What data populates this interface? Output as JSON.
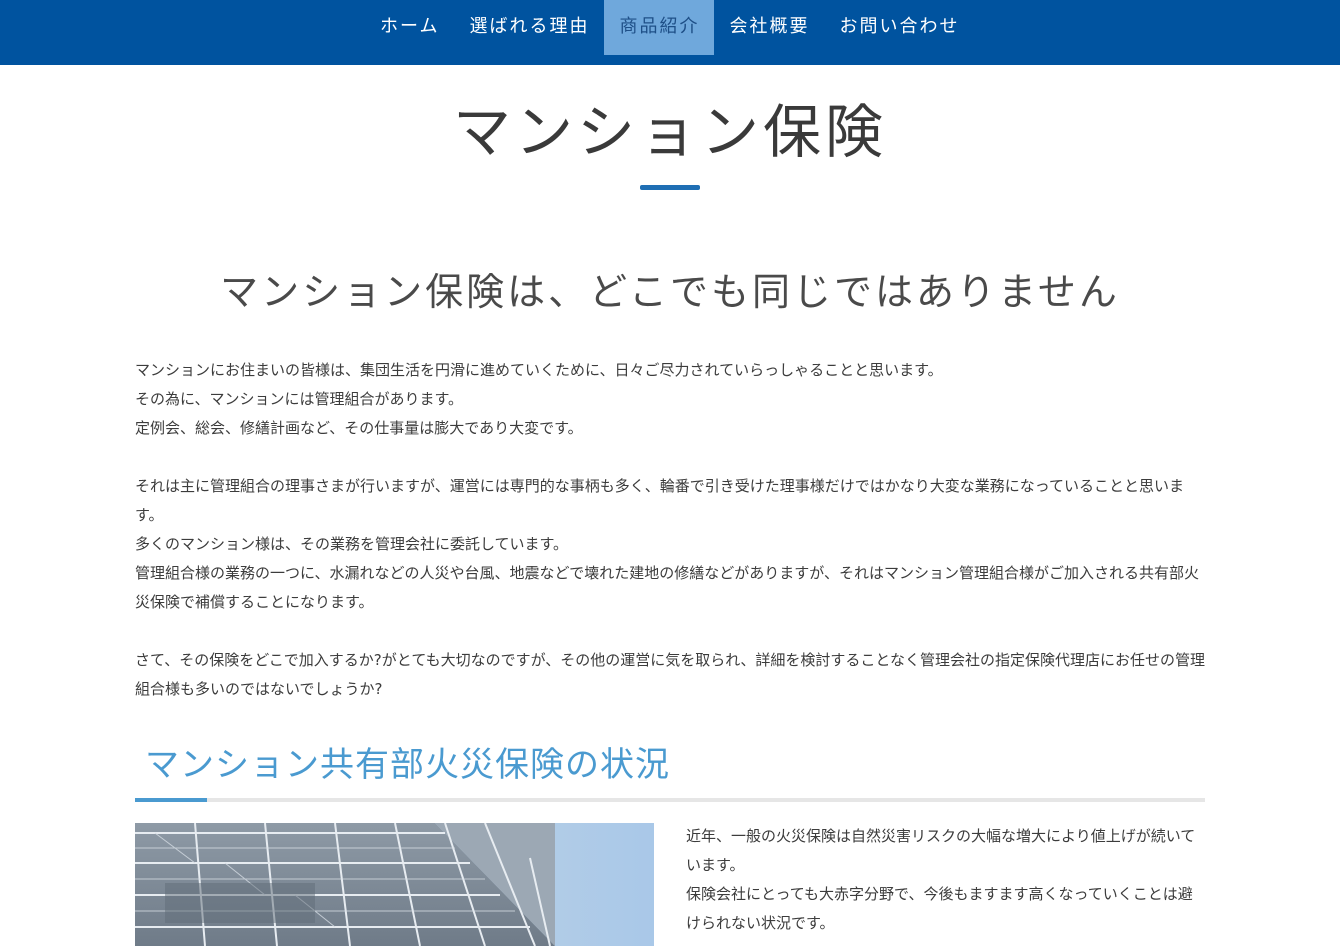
{
  "nav": {
    "items": [
      {
        "label": "ホーム",
        "active": false
      },
      {
        "label": "選ばれる理由",
        "active": false
      },
      {
        "label": "商品紹介",
        "active": true
      },
      {
        "label": "会社概要",
        "active": false
      },
      {
        "label": "お問い合わせ",
        "active": false
      }
    ]
  },
  "page": {
    "title": "マンション保険",
    "subtitle": "マンション保険は、どこでも同じではありません"
  },
  "intro": {
    "p1": "マンションにお住まいの皆様は、集団生活を円滑に進めていくために、日々ご尽力されていらっしゃることと思います。",
    "p2": "その為に、マンションには管理組合があります。",
    "p3": "定例会、総会、修繕計画など、その仕事量は膨大であり大変です。",
    "p4": "それは主に管理組合の理事さまが行いますが、運営には専門的な事柄も多く、輪番で引き受けた理事様だけではかなり大変な業務になっていることと思います。",
    "p5": "多くのマンション様は、その業務を管理会社に委託しています。",
    "p6": "管理組合様の業務の一つに、水漏れなどの人災や台風、地震などで壊れた建地の修繕などがありますが、それはマンション管理組合様がご加入される共有部火災保険で補償することになります。",
    "p7": "さて、その保険をどこで加入するか?がとても大切なのですが、その他の運営に気を取られ、詳細を検討することなく管理会社の指定保険代理店にお任せの管理組合様も多いのではないでしょうか?"
  },
  "section": {
    "heading": "マンション共有部火災保険の状況",
    "text1": "近年、一般の火災保険は自然災害リスクの大幅な増大により値上げが続いています。",
    "text2": "保険会社にとっても大赤字分野で、今後もますます高くなっていくことは避けられない状況です。"
  },
  "colors": {
    "nav_bg": "#00539f",
    "nav_active_bg": "#6fa8dc",
    "accent": "#4a9ad0",
    "title_bar": "#1f6fb4"
  }
}
